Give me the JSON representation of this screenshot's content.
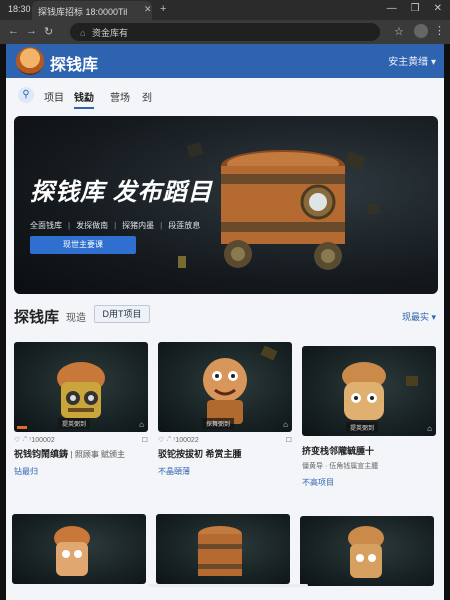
{
  "browser": {
    "time": "18:30",
    "tab_title": "探钱库招标 18:0000Til",
    "tab_close": "✕",
    "tab_add": "+",
    "window_controls": [
      "—",
      "❐",
      "✕"
    ],
    "nav": {
      "back": "←",
      "forward": "→",
      "reload": "↻",
      "home": "⌂"
    },
    "url": "资金库有",
    "star": "☆",
    "menu": "⋮"
  },
  "header": {
    "brand": "探钱库",
    "user_menu": "安主黄缙 ▾"
  },
  "nav_tabs": [
    {
      "label": "项目"
    },
    {
      "label": "钱勐",
      "active": true
    },
    {
      "label": "营场"
    },
    {
      "label": "刭"
    }
  ],
  "hero": {
    "title": "探钱库 发布蹈目",
    "features": [
      "全面钱库",
      "发探做南",
      "探猪内墨",
      "段莲放息"
    ],
    "cta": "现世主要课"
  },
  "section": {
    "title": "探钱库",
    "subtitle": "现造",
    "button": "D用T项目",
    "more": "现最实 ▾"
  },
  "cards": [
    {
      "tag": "提英弼到",
      "meta_left": "♡ ·˜ ⁷100002",
      "meta_right": "☐",
      "title": "祝钱钧鬧缜鋳",
      "title_sub": "| 照顾事 赋颁主",
      "link": "钻最归"
    },
    {
      "tag": "探舞弼到",
      "meta_left": "♡ ·˜ ⁷100022",
      "meta_right": "☐",
      "title": "驳铊按拔初 希赏主腫",
      "title_sub": "",
      "link": "不晶頤薄"
    },
    {
      "tag": "提英弼到",
      "meta_left": "",
      "meta_right": "",
      "title": "挤变栈邻隴毓腫十",
      "title_sub": "僵黄导 · 伍角钱属宣主腫",
      "link": "不高项目"
    }
  ]
}
